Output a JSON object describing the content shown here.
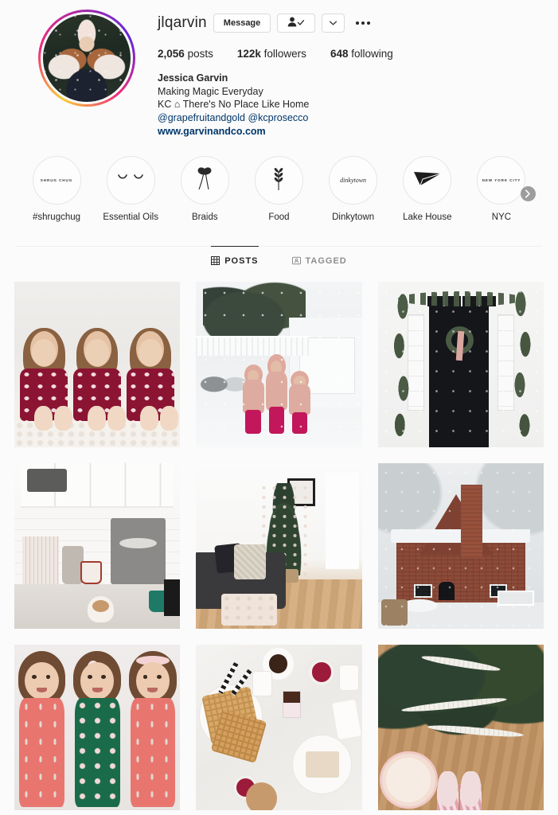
{
  "profile": {
    "username": "jlqarvin",
    "avatar_alt": "woman-in-snow-with-white-hat",
    "has_story_ring": true,
    "buttons": {
      "message": "Message",
      "following_icon": "person-check-icon",
      "dropdown_icon": "chevron-down-icon",
      "more_icon": "ellipsis-icon"
    },
    "stats": [
      {
        "value": "2,056",
        "label": "posts"
      },
      {
        "value": "122k",
        "label": "followers"
      },
      {
        "value": "648",
        "label": "following"
      }
    ],
    "bio": {
      "full_name": "Jessica Garvin",
      "lines": [
        "Making Magic Everyday",
        "KC ⌂ There's No Place Like Home"
      ],
      "mentions": "@grapefruitandgold @kcprosecco",
      "website": "www.garvinandco.com"
    }
  },
  "highlights": {
    "next_icon": "chevron-right-icon",
    "items": [
      {
        "label": "#shrugchug",
        "cover": "text-shrug-chug",
        "cover_text": "SHRUG CHUG"
      },
      {
        "label": "Essential Oils",
        "cover": "closed-eyes-icon"
      },
      {
        "label": "Braids",
        "cover": "braid-bow-icon"
      },
      {
        "label": "Food",
        "cover": "wheat-sprig-icon"
      },
      {
        "label": "Dinkytown",
        "cover": "script-dinkytown",
        "cover_text": "dinkytown"
      },
      {
        "label": "Lake House",
        "cover": "paper-plane-icon"
      },
      {
        "label": "NYC",
        "cover": "text-new-york-city",
        "cover_text": "NEW YORK CITY"
      }
    ]
  },
  "tabs": [
    {
      "label": "POSTS",
      "icon": "grid-icon",
      "active": true
    },
    {
      "label": "TAGGED",
      "icon": "tag-person-icon",
      "active": false
    }
  ],
  "grid": {
    "posts": [
      {
        "alt": "three-girls-maroon-pajamas-on-bed",
        "art": "p1"
      },
      {
        "alt": "three-girls-pink-snowsuits-in-snowy-yard",
        "art": "p2"
      },
      {
        "alt": "black-front-door-with-christmas-wreath-and-garland",
        "art": "p3"
      },
      {
        "alt": "kitchen-coffee-bar-with-espresso-machine",
        "art": "p4"
      },
      {
        "alt": "living-room-with-christmas-tree-and-tufted-ottoman",
        "art": "p5"
      },
      {
        "alt": "brick-tudor-house-in-snow",
        "art": "p6"
      },
      {
        "alt": "three-girls-christmas-pajamas-top-down",
        "art": "p7"
      },
      {
        "alt": "waffle-breakfast-flatlay-on-marble",
        "art": "p8"
      },
      {
        "alt": "christmas-tree-top-down-with-feet-and-latte",
        "art": "p9"
      }
    ]
  },
  "colors": {
    "background": "#fbfbfb",
    "text_primary": "#262626",
    "text_secondary": "#8e8e8e",
    "link": "#00376b",
    "border": "#dbdbdb",
    "divider": "#efefef"
  }
}
